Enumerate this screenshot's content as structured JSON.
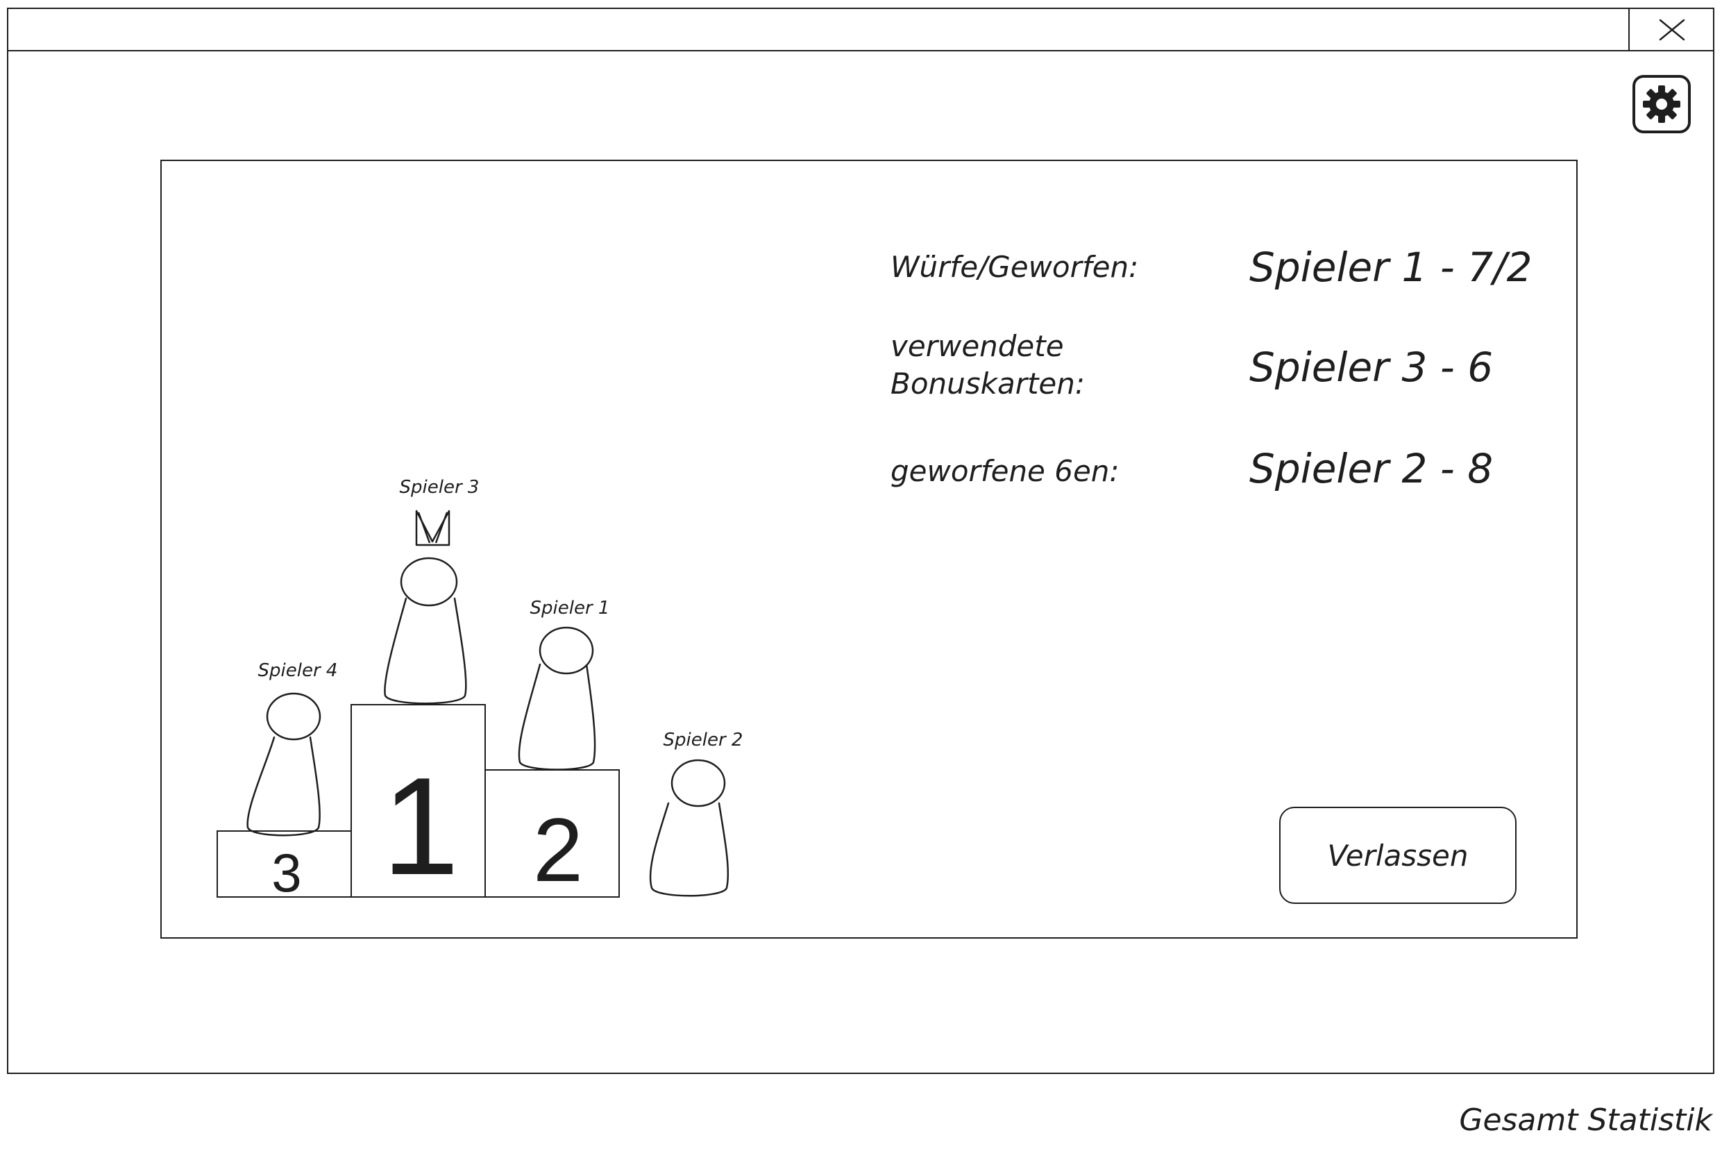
{
  "window": {
    "close_icon": "close-icon",
    "settings_icon": "gear-icon"
  },
  "podium": {
    "places": [
      {
        "number": "1",
        "player": "Spieler 3",
        "crowned": true
      },
      {
        "number": "2",
        "player": "Spieler 1",
        "crowned": false
      },
      {
        "number": "3",
        "player": "Spieler 4",
        "crowned": false
      }
    ],
    "off_podium": {
      "player": "Spieler 2"
    }
  },
  "stats": [
    {
      "label": "Würfe/Geworfen:",
      "value": "Spieler 1 - 7/2"
    },
    {
      "label_line1": "verwendete",
      "label_line2": "Bonuskarten:",
      "value": "Spieler 3 - 6"
    },
    {
      "label": "geworfene 6en:",
      "value": "Spieler 2 - 8"
    }
  ],
  "actions": {
    "leave_label": "Verlassen"
  },
  "caption": "Gesamt Statistik"
}
